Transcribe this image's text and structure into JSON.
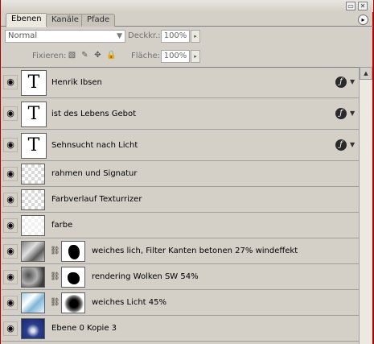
{
  "window": {
    "collapse_glyph": "▭",
    "close_glyph": "✕"
  },
  "tabs": [
    {
      "label": "Ebenen",
      "active": true
    },
    {
      "label": "Kanäle",
      "active": false
    },
    {
      "label": "Pfade",
      "active": false
    }
  ],
  "panel_menu_glyph": "▸",
  "blend_mode": {
    "value": "Normal",
    "arrow": "▼"
  },
  "opacity": {
    "label": "Deckkr.:",
    "value": "100%"
  },
  "lock": {
    "label": "Fixieren:"
  },
  "fill": {
    "label": "Fläche:",
    "value": "100%"
  },
  "stepper_glyph": "▸",
  "icons": {
    "eye": "◉",
    "chain": "⛓",
    "fx": "ƒ",
    "fx_arrow": "▼",
    "scroll_up": "▲",
    "lock_pixels": "▧",
    "lock_brush": "✎",
    "lock_move": "✥",
    "lock_all": "🔒"
  },
  "layers": [
    {
      "name": "Henrik Ibsen",
      "thumb_text": "T",
      "effects": true
    },
    {
      "name": "ist des  Lebens Gebot",
      "thumb_text": "T",
      "effects": true
    },
    {
      "name": "Sehnsucht  nach Licht",
      "thumb_text": "T",
      "effects": true
    },
    {
      "name": "rahmen und Signatur"
    },
    {
      "name": "Farbverlauf Texturrizer"
    },
    {
      "name": "farbe"
    },
    {
      "name": "weiches lich, Filter Kanten betonen 27% windeffekt",
      "mask": true
    },
    {
      "name": "rendering Wolken SW 54%",
      "mask": true
    },
    {
      "name": "weiches Licht 45%",
      "mask": true
    },
    {
      "name": "Ebene 0 Kopie 3"
    }
  ]
}
